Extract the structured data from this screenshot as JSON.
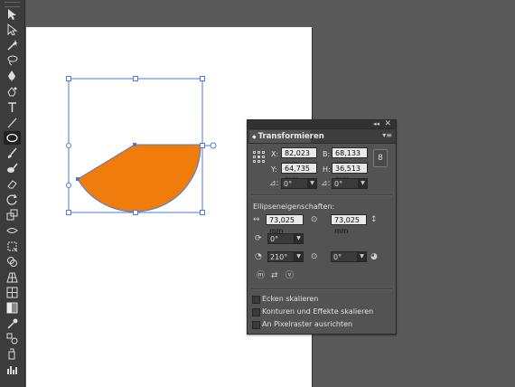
{
  "toolbar": {
    "tools": [
      {
        "name": "selection-tool-icon"
      },
      {
        "name": "direct-selection-tool-icon"
      },
      {
        "name": "magic-wand-tool-icon"
      },
      {
        "name": "lasso-tool-icon"
      },
      {
        "name": "pen-tool-icon"
      },
      {
        "name": "curvature-tool-icon"
      },
      {
        "name": "type-tool-icon"
      },
      {
        "name": "line-segment-tool-icon"
      },
      {
        "name": "ellipse-tool-icon",
        "active": true
      },
      {
        "name": "paintbrush-tool-icon"
      },
      {
        "name": "blob-brush-tool-icon"
      },
      {
        "name": "eraser-tool-icon"
      },
      {
        "name": "rotate-tool-icon"
      },
      {
        "name": "scale-tool-icon"
      },
      {
        "name": "width-tool-icon"
      },
      {
        "name": "free-transform-tool-icon"
      },
      {
        "name": "shape-builder-tool-icon"
      },
      {
        "name": "perspective-grid-tool-icon"
      },
      {
        "name": "mesh-tool-icon"
      },
      {
        "name": "gradient-tool-icon"
      },
      {
        "name": "eyedropper-tool-icon"
      },
      {
        "name": "blend-tool-icon"
      },
      {
        "name": "symbol-sprayer-tool-icon"
      },
      {
        "name": "column-graph-tool-icon"
      }
    ]
  },
  "canvas": {
    "shape_fill": "#F07C0C",
    "selection_color": "#4A7BE0",
    "artboard_color": "#FFFFFF"
  },
  "panel": {
    "tab_label": "Transformieren",
    "x_label": "X:",
    "x_value": "82,023 mm",
    "y_label": "Y:",
    "y_value": "64,735 mm",
    "b_label": "B:",
    "b_value": "68,133 mm",
    "h_label": "H:",
    "h_value": "36,513 mm",
    "rotate_value": "0°",
    "shear_value": "0°",
    "ellipse_section_title": "Ellipseneigenschaften:",
    "ellipse_width": "73,025 mm",
    "ellipse_height": "73,025 mm",
    "ellipse_angle": "0°",
    "pie_start": "210°",
    "pie_end": "0°",
    "checkboxes": [
      {
        "label": "Ecken skalieren",
        "checked": false
      },
      {
        "label": "Konturen und Effekte skalieren",
        "checked": false
      },
      {
        "label": "An Pixelraster ausrichten",
        "checked": false
      }
    ]
  }
}
